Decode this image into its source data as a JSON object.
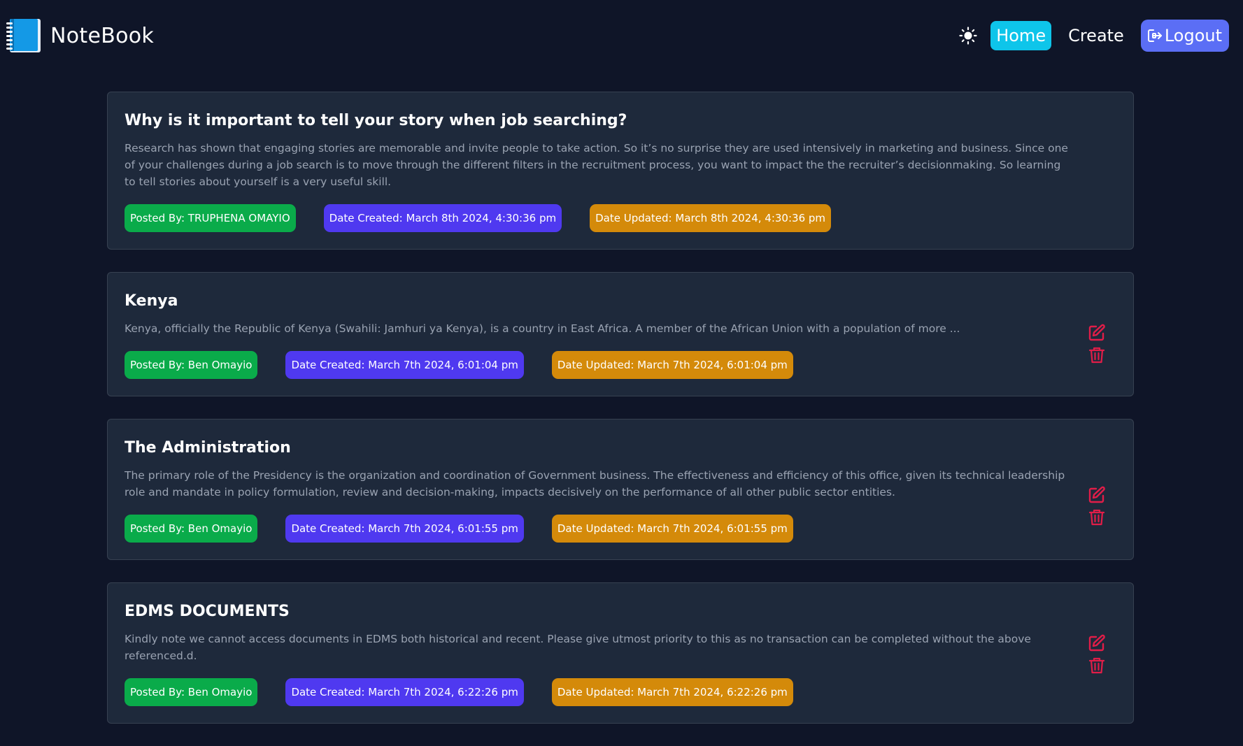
{
  "app": {
    "name": "NoteBook"
  },
  "nav": {
    "theme_icon": "sun-icon",
    "home_label": "Home",
    "create_label": "Create",
    "logout_label": "Logout"
  },
  "colors": {
    "background": "#0f1528",
    "card": "#1e293b",
    "home_active": "#0ec5ea",
    "logout": "#5b6ef5",
    "posted_by_badge": "#0aab4a",
    "created_badge": "#4f39f0",
    "updated_badge": "#d48a0a",
    "action_icons": "#e11d48"
  },
  "notes": [
    {
      "title": "Why is it important to tell your story when job searching?",
      "body": "Research has shown that engaging stories are memorable and invite people to take action. So it’s no surprise they are used intensively in marketing and business. Since one of your challenges during a job search is to move through the different filters in the recruitment process, you want to impact the the recruiter’s decisionmaking. So learning to tell stories about yourself is a very useful skill.",
      "posted_by": "Posted By: TRUPHENA OMAYIO",
      "created": "Date Created: March 8th 2024, 4:30:36 pm",
      "updated": "Date Updated: March 8th 2024, 4:30:36 pm",
      "editable": false
    },
    {
      "title": "Kenya",
      "body": "Kenya, officially the Republic of Kenya (Swahili: Jamhuri ya Kenya), is a country in East Africa. A member of the African Union with a population of more ...",
      "posted_by": "Posted By: Ben Omayio",
      "created": "Date Created: March 7th 2024, 6:01:04 pm",
      "updated": "Date Updated: March 7th 2024, 6:01:04 pm",
      "editable": true
    },
    {
      "title": "The Administration",
      "body": "The primary role of the Presidency is the organization and coordination of Government business. The effectiveness and efficiency of this office, given its technical leadership role and mandate in policy formulation, review and decision-making, impacts decisively on the performance of all other public sector entities.",
      "posted_by": "Posted By: Ben Omayio",
      "created": "Date Created: March 7th 2024, 6:01:55 pm",
      "updated": "Date Updated: March 7th 2024, 6:01:55 pm",
      "editable": true
    },
    {
      "title": "EDMS DOCUMENTS",
      "body": "Kindly note we cannot access documents in EDMS both historical and recent. Please give utmost priority to this as no transaction can be completed without the above referenced.d.",
      "posted_by": "Posted By: Ben Omayio",
      "created": "Date Created: March 7th 2024, 6:22:26 pm",
      "updated": "Date Updated: March 7th 2024, 6:22:26 pm",
      "editable": true
    }
  ]
}
